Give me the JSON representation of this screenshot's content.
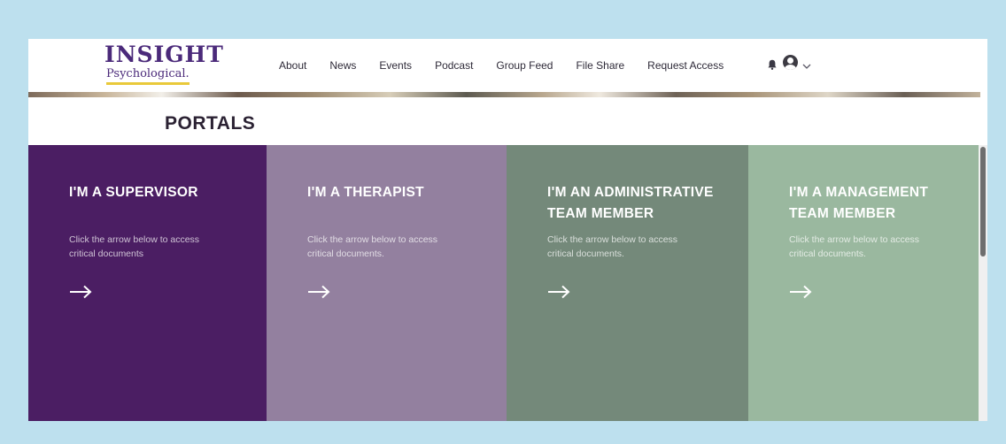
{
  "brand": {
    "logo_main": "INSIGHT",
    "logo_sub": "Psychological."
  },
  "nav": {
    "items": [
      "About",
      "News",
      "Events",
      "Podcast",
      "Group Feed",
      "File Share",
      "Request Access"
    ]
  },
  "header_icons": [
    "bell-icon",
    "avatar-icon",
    "chevron-down-icon"
  ],
  "page": {
    "heading": "PORTALS"
  },
  "portals": [
    {
      "title": "I'M A SUPERVISOR",
      "description": "Click the arrow below to access critical documents",
      "color": "#4b1e63",
      "arrow": "→"
    },
    {
      "title": "I'M A THERAPIST",
      "description": "Click the arrow below to access critical documents.",
      "color": "#93809f",
      "arrow": "→"
    },
    {
      "title": "I'M AN ADMINISTRATIVE TEAM MEMBER",
      "description": "Click the arrow below to access critical documents.",
      "color": "#74897a",
      "arrow": "→"
    },
    {
      "title": "I'M A MANAGEMENT TEAM MEMBER",
      "description": "Click the arrow below to access critical documents.",
      "color": "#9ab89f",
      "arrow": "→"
    }
  ],
  "colors": {
    "page_bg": "#bde0ee",
    "brand_purple": "#4b2a7a",
    "brand_gold": "#e9c93a"
  }
}
